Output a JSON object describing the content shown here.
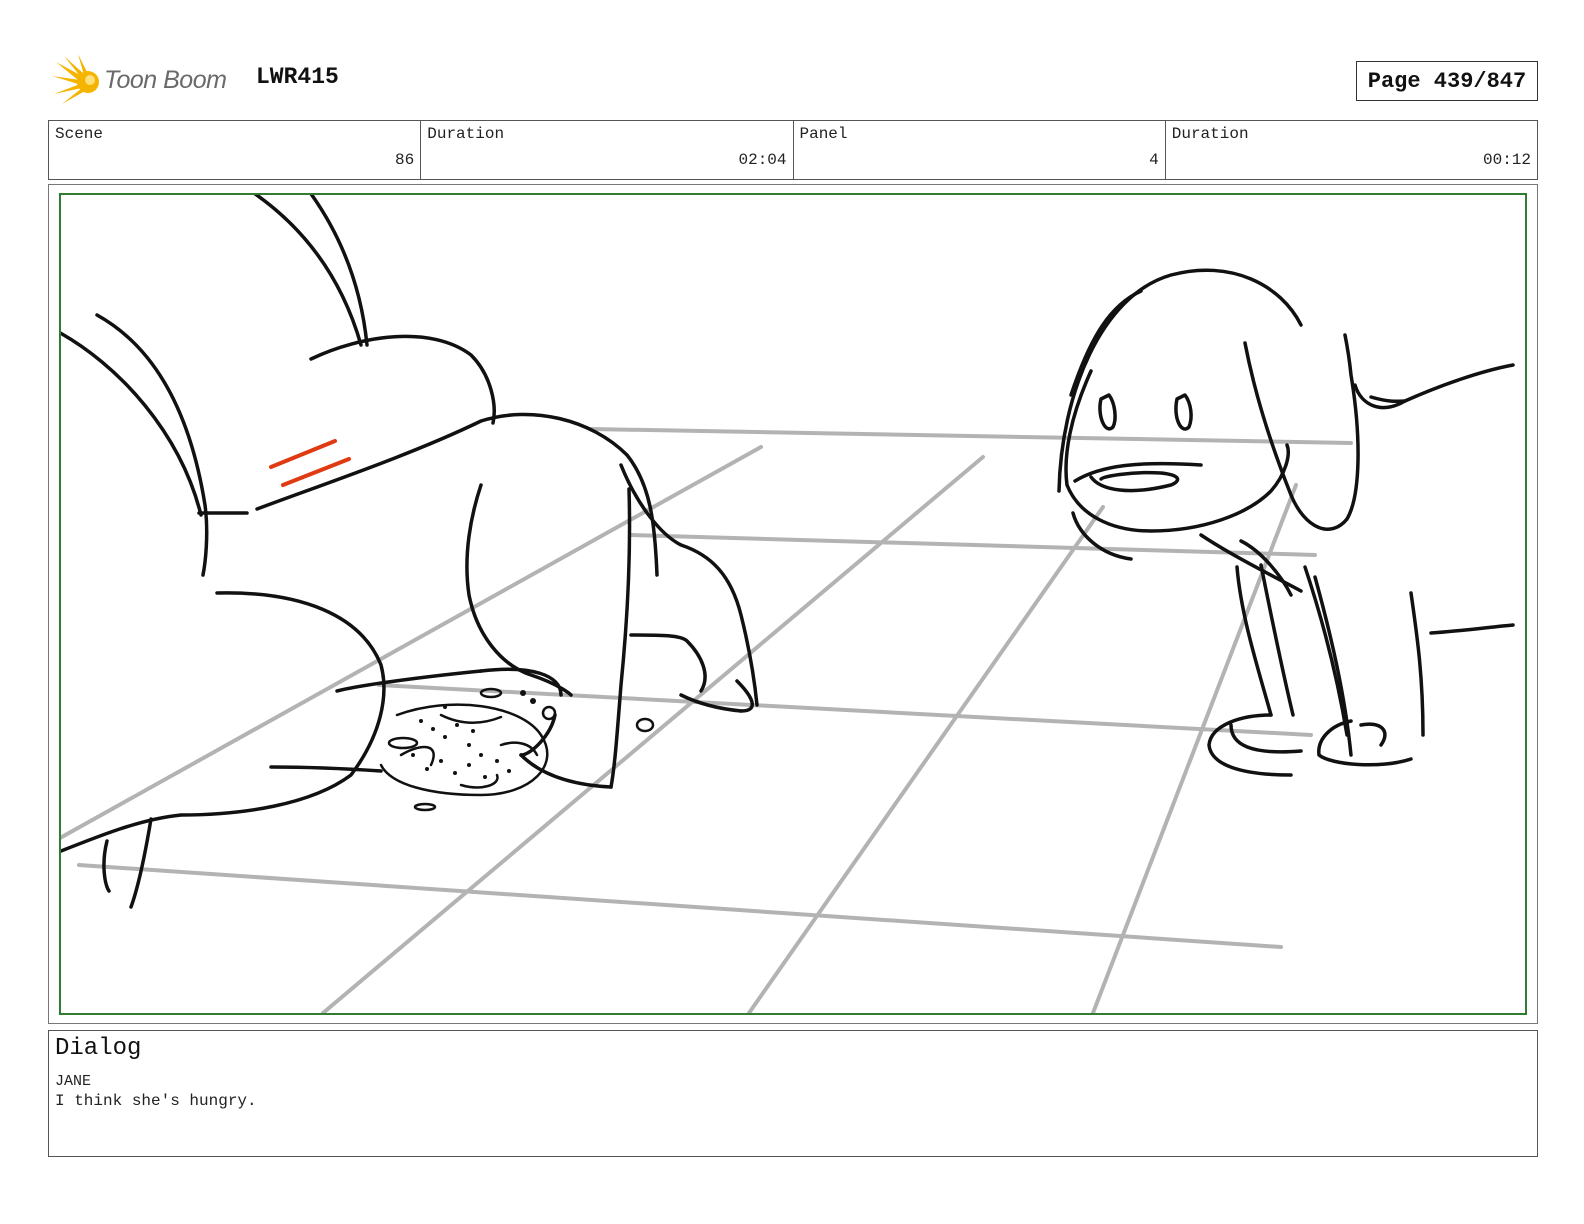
{
  "header": {
    "logo_text": "Toon Boom",
    "project_code": "LWR415",
    "page_label": "Page 439/847",
    "brand_color": "#f5b400"
  },
  "info_bar": {
    "scene": {
      "label": "Scene",
      "value": "86"
    },
    "scene_duration": {
      "label": "Duration",
      "value": "02:04"
    },
    "panel": {
      "label": "Panel",
      "value": "4"
    },
    "panel_duration": {
      "label": "Duration",
      "value": "00:12"
    }
  },
  "panel_image": {
    "frame_color": "#2e7d32",
    "accent_color": "#e03a12"
  },
  "dialog": {
    "title": "Dialog",
    "speaker": "JANE",
    "line": "I think she's hungry."
  }
}
